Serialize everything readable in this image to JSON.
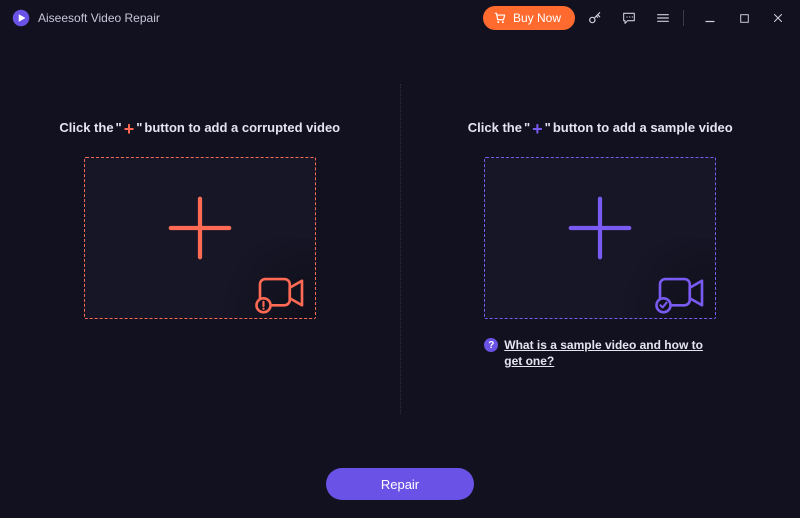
{
  "app": {
    "title": "Aiseesoft Video Repair"
  },
  "titlebar": {
    "buy_label": "Buy Now"
  },
  "panels": {
    "left": {
      "title_pre": "Click the ",
      "title_post": " button to add a corrupted video",
      "plus": "+"
    },
    "right": {
      "title_pre": "Click the ",
      "title_post": " button to add a sample video",
      "plus": "+",
      "help_text": "What is a sample video and how to get one?",
      "help_badge": "?"
    }
  },
  "footer": {
    "repair_label": "Repair"
  },
  "colors": {
    "accent_red": "#ff6a55",
    "accent_purple": "#7a5bf2",
    "button_purple": "#6b52e6",
    "buy_orange": "#ff6a2f"
  }
}
